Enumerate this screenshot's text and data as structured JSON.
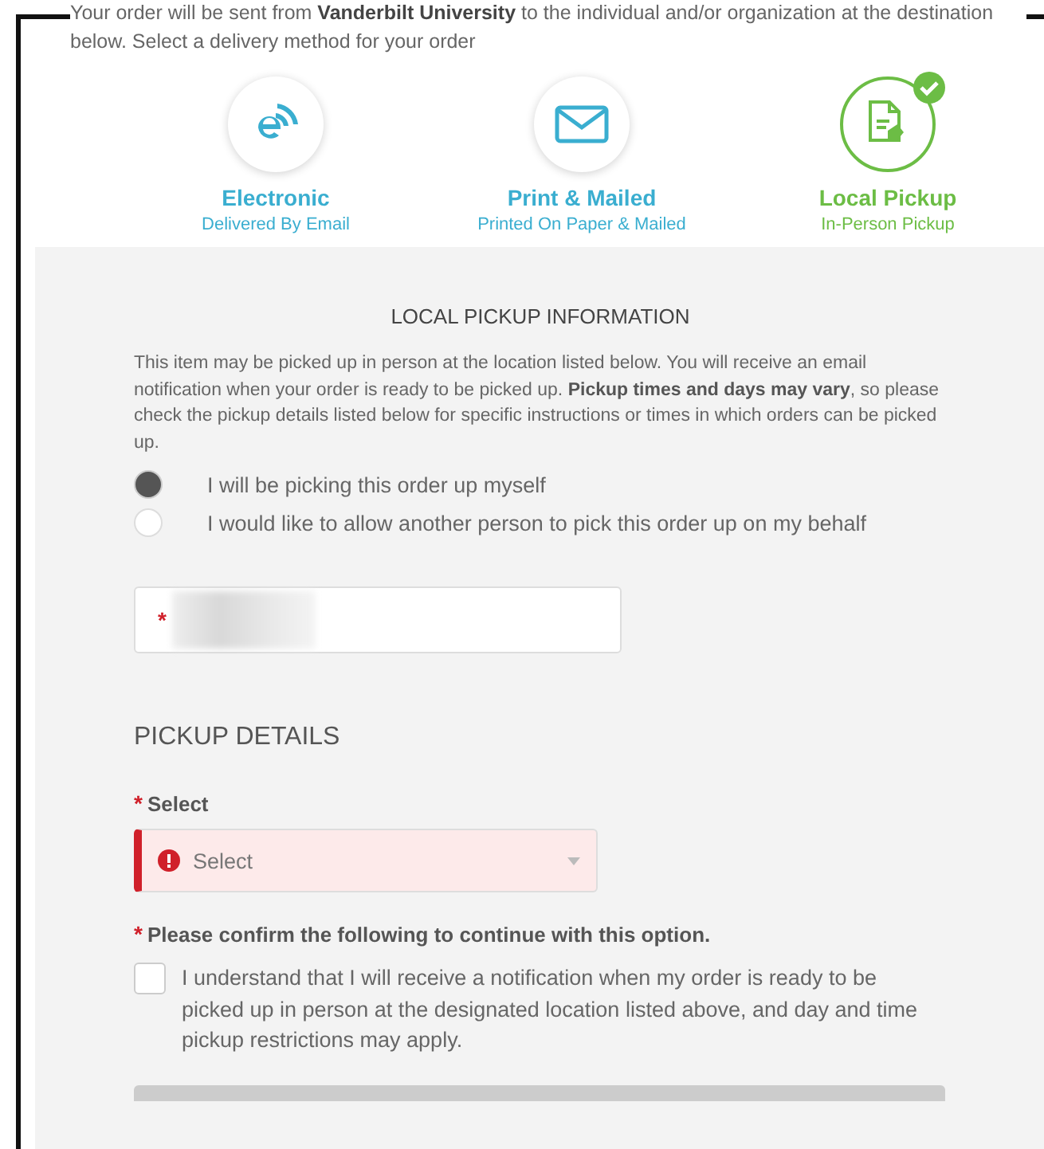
{
  "intro": "Your order will be sent from **Vanderbilt University** to the individual and/or organization at the destination below. Select a delivery method for your order",
  "methods": [
    {
      "kind": "electronic",
      "title": "Electronic",
      "subtitle": "Delivered By Email",
      "selected": false
    },
    {
      "kind": "mail",
      "title": "Print & Mailed",
      "subtitle": "Printed On Paper & Mailed",
      "selected": false
    },
    {
      "kind": "pickup",
      "title": "Local Pickup",
      "subtitle": "In-Person Pickup",
      "selected": true
    }
  ],
  "pickup_info": {
    "heading": "LOCAL PICKUP INFORMATION",
    "text": "This item may be picked up in person at the location listed below. You will receive an email notification when your order is ready to be picked up. **Pickup times and days may vary**, so please check the pickup details listed below for specific instructions or times in which orders can be picked up.",
    "options": [
      {
        "label": "I will be picking this order up myself",
        "selected": true
      },
      {
        "label": "I would like to allow another person to pick this order up on my behalf",
        "selected": false
      }
    ],
    "field": {
      "required_mark": "*"
    }
  },
  "pickup_details": {
    "heading": "PICKUP DETAILS",
    "select_label": {
      "mark": "*",
      "text": "Select"
    },
    "select": {
      "placeholder": "Select",
      "error": true
    },
    "confirm_label": {
      "mark": "*",
      "text": "Please confirm the following to continue with this option."
    },
    "confirm": {
      "label": "I understand that I will receive a notification when my order is ready to be picked up in person at the designated location listed above, and day and time pickup restrictions may apply.",
      "checked": false
    }
  }
}
